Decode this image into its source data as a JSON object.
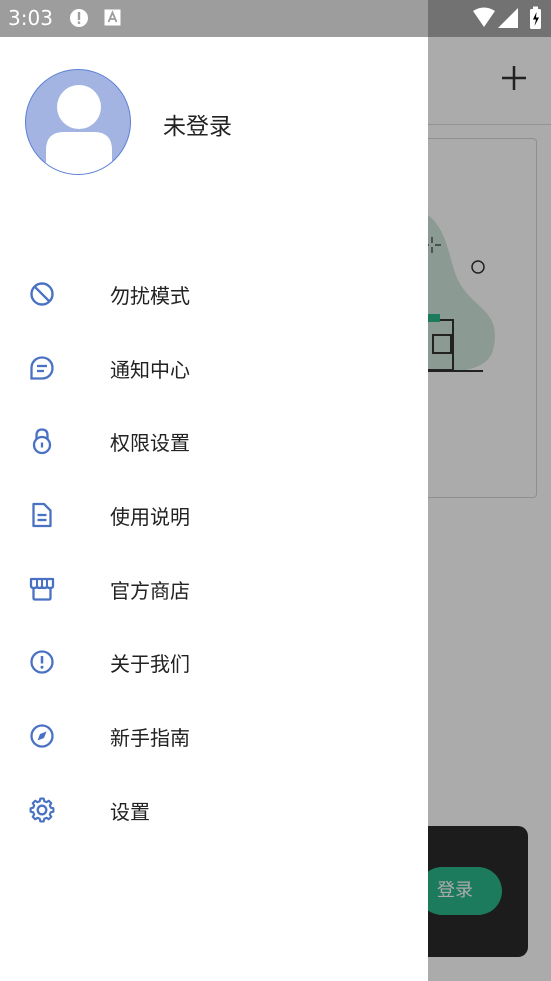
{
  "status_bar": {
    "time": "3:03"
  },
  "app_background": {
    "login_button_label": "登录"
  },
  "drawer": {
    "username": "未登录",
    "accent_color": "#4a72c4",
    "items": [
      {
        "label": "勿扰模式",
        "icon": "do-not-disturb-icon"
      },
      {
        "label": "通知中心",
        "icon": "message-icon"
      },
      {
        "label": "权限设置",
        "icon": "lock-icon"
      },
      {
        "label": "使用说明",
        "icon": "document-icon"
      },
      {
        "label": "官方商店",
        "icon": "store-icon"
      },
      {
        "label": "关于我们",
        "icon": "info-icon"
      },
      {
        "label": "新手指南",
        "icon": "compass-icon"
      },
      {
        "label": "设置",
        "icon": "gear-icon"
      }
    ]
  }
}
